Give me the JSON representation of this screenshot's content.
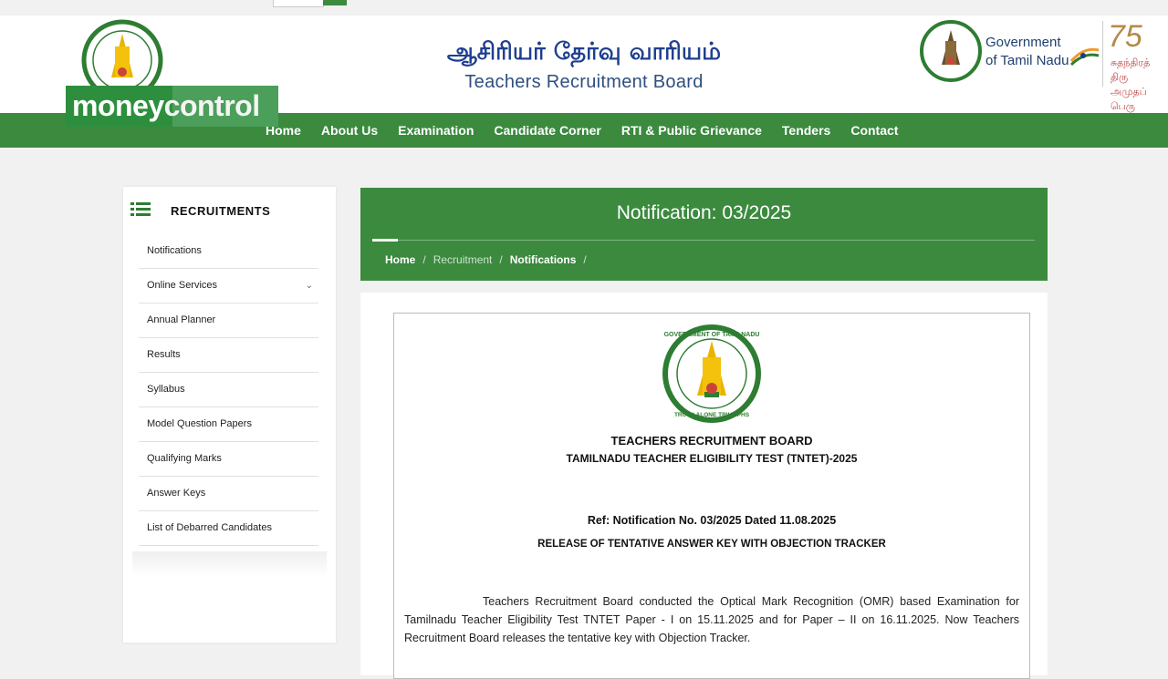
{
  "header": {
    "title_tamil": "ஆசிரியர் தேர்வு வாரியம்",
    "title_english": "Teachers Recruitment Board",
    "gov_line1": "Government",
    "gov_line2": "of Tamil Nadu",
    "ama_number": "75",
    "ama_tamil_line1": "சுதந்திரத் திரு",
    "ama_tamil_line2": "அமுதப் பெரு",
    "watermark_money": "money",
    "watermark_control": "control"
  },
  "nav": {
    "items": [
      "Home",
      "About Us",
      "Examination",
      "Candidate Corner",
      "RTI & Public Grievance",
      "Tenders",
      "Contact"
    ]
  },
  "sidebar": {
    "title": "RECRUITMENTS",
    "items": [
      {
        "label": "Notifications"
      },
      {
        "label": "Online Services",
        "chevron": true
      },
      {
        "label": "Annual Planner"
      },
      {
        "label": "Results"
      },
      {
        "label": "Syllabus"
      },
      {
        "label": "Model Question Papers"
      },
      {
        "label": "Qualifying Marks"
      },
      {
        "label": "Answer Keys"
      },
      {
        "label": "List of Debarred Candidates"
      }
    ]
  },
  "main": {
    "title": "Notification: 03/2025",
    "breadcrumb": [
      "Home",
      "Recruitment",
      "Notifications"
    ],
    "breadcrumb_sep": "/"
  },
  "doc": {
    "seal_top": "GOVERNMENT OF TAMILNADU",
    "seal_bottom": "TRUTH ALONE TRIUMPHS",
    "line1": "TEACHERS RECRUITMENT BOARD",
    "line2": "TAMILNADU TEACHER ELIGIBILITY TEST (TNTET)-2025",
    "ref": "Ref: Notification No. 03/2025 Dated 11.08.2025",
    "release": "RELEASE OF TENTATIVE ANSWER KEY WITH OBJECTION TRACKER",
    "paragraph": "Teachers Recruitment Board conducted the Optical Mark Recognition (OMR) based Examination for Tamilnadu Teacher Eligibility Test TNTET Paper - I on 15.11.2025 and for Paper – II on 16.11.2025. Now Teachers Recruitment Board releases the tentative key with Objection Tracker."
  },
  "colors": {
    "brand_green": "#3b8a3e",
    "title_blue": "#1f3f8f"
  }
}
